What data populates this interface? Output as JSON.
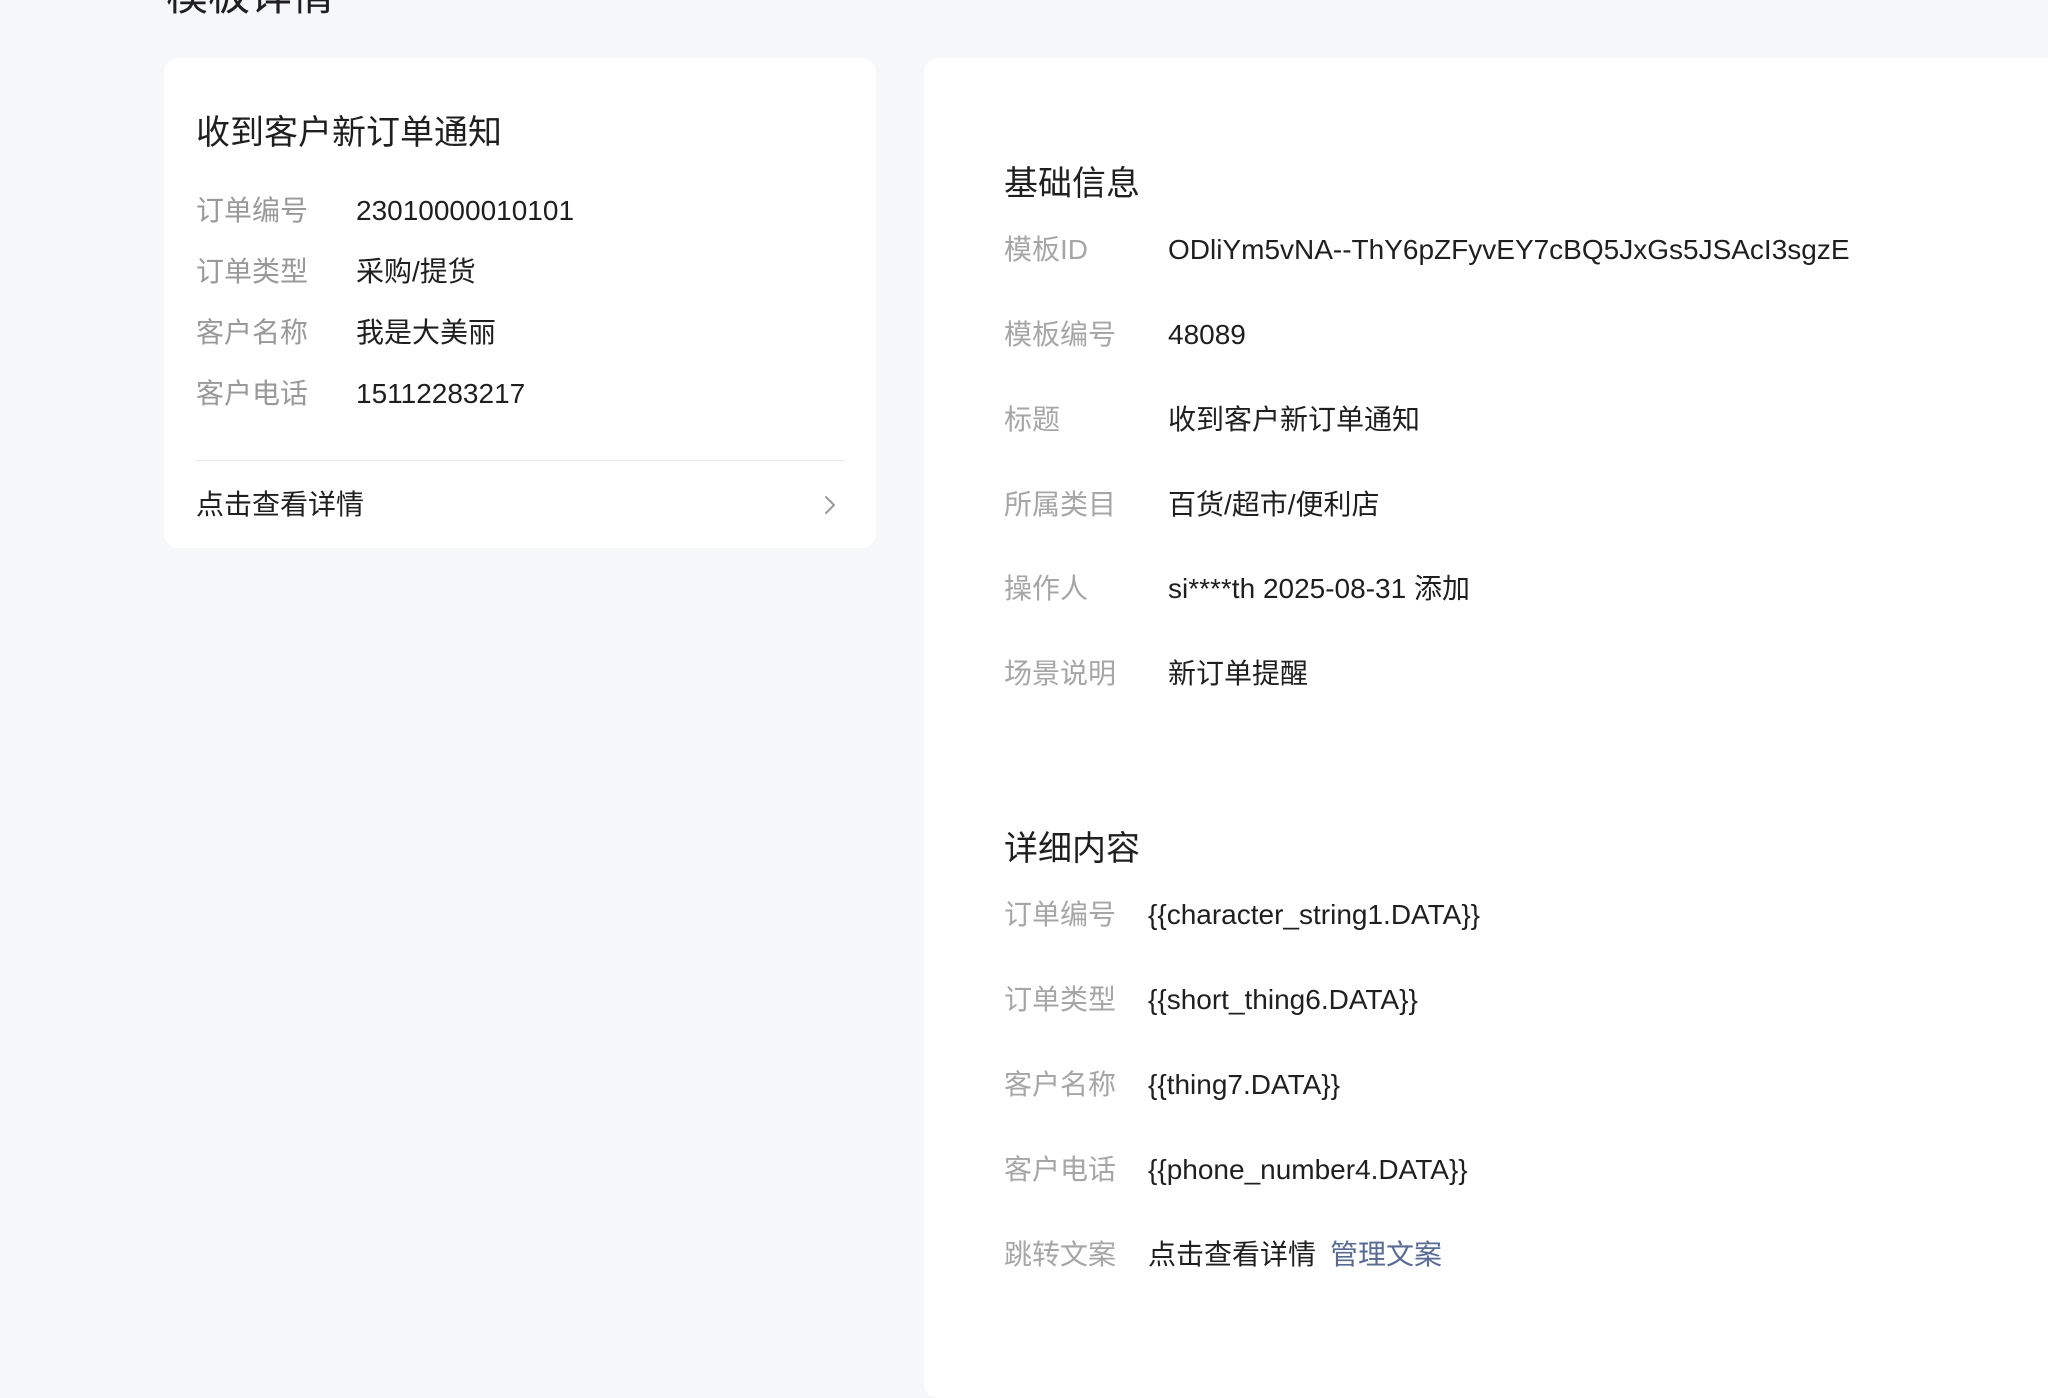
{
  "page": {
    "title": "模板详情"
  },
  "preview": {
    "title": "收到客户新订单通知",
    "rows": [
      {
        "label": "订单编号",
        "value": "23010000010101"
      },
      {
        "label": "订单类型",
        "value": "采购/提货"
      },
      {
        "label": "客户名称",
        "value": "我是大美丽"
      },
      {
        "label": "客户电话",
        "value": "15112283217"
      }
    ],
    "link_label": "点击查看详情",
    "link_icon": "chevron-right-icon"
  },
  "basic_info": {
    "title": "基础信息",
    "rows": [
      {
        "label": "模板ID",
        "value": "ODliYm5vNA--ThY6pZFyvEY7cBQ5JxGs5JSAcI3sgzE"
      },
      {
        "label": "模板编号",
        "value": "48089"
      },
      {
        "label": "标题",
        "value": "收到客户新订单通知"
      },
      {
        "label": "所属类目",
        "value": "百货/超市/便利店"
      },
      {
        "label": "操作人",
        "value": "si****th 2025-08-31 添加"
      },
      {
        "label": "场景说明",
        "value": "新订单提醒"
      }
    ]
  },
  "detail_content": {
    "title": "详细内容",
    "rows": [
      {
        "label": "订单编号",
        "value": "{{character_string1.DATA}}"
      },
      {
        "label": "订单类型",
        "value": "{{short_thing6.DATA}}"
      },
      {
        "label": "客户名称",
        "value": "{{thing7.DATA}}"
      },
      {
        "label": "客户电话",
        "value": "{{phone_number4.DATA}}"
      },
      {
        "label": "跳转文案",
        "value": "点击查看详情",
        "action": "管理文案"
      }
    ]
  },
  "colors": {
    "page_bg": "#f6f7f9",
    "card_bg": "#ffffff",
    "label_gray": "#a6a6a6",
    "text": "#1f1f1f",
    "link_blue": "#576b95"
  }
}
